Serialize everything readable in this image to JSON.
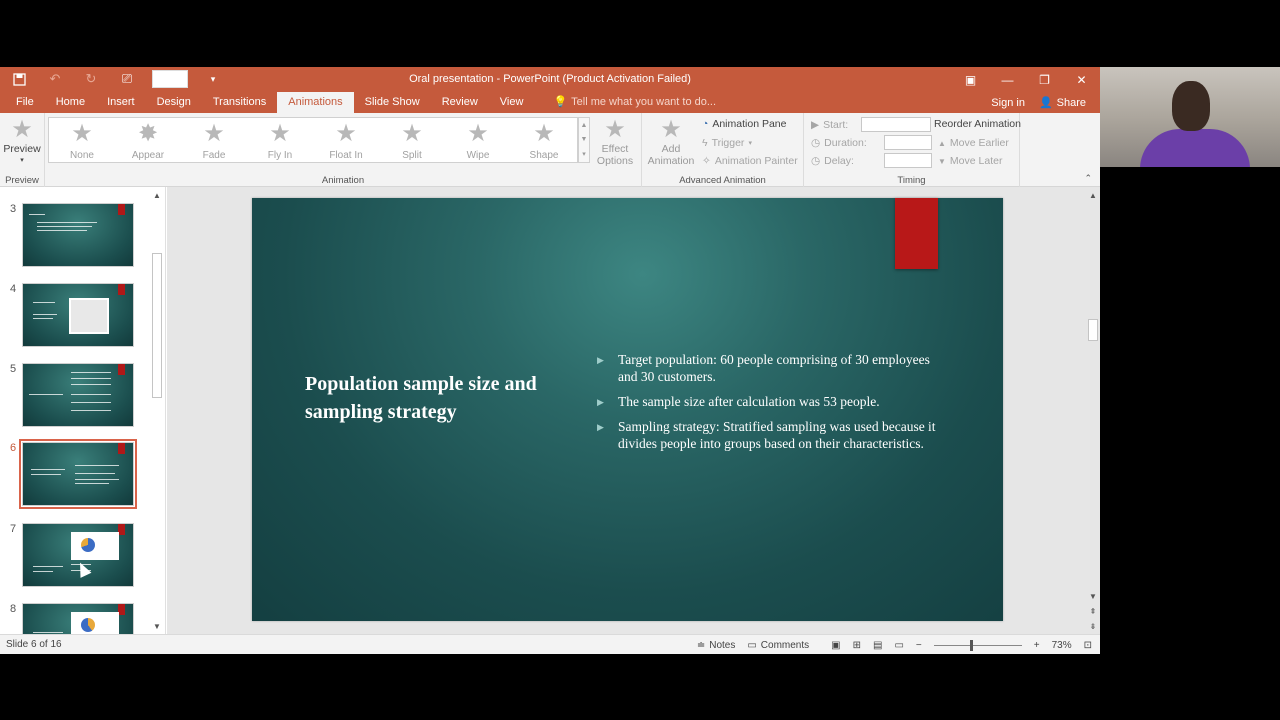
{
  "window": {
    "title": "Oral presentation - PowerPoint (Product Activation Failed)"
  },
  "tabs": {
    "file": "File",
    "home": "Home",
    "insert": "Insert",
    "design": "Design",
    "transitions": "Transitions",
    "animations": "Animations",
    "slideshow": "Slide Show",
    "review": "Review",
    "view": "View",
    "tell": "Tell me what you want to do...",
    "signin": "Sign in",
    "share": "Share"
  },
  "ribbon": {
    "preview": "Preview",
    "preview_group": "Preview",
    "animation_group": "Animation",
    "animations": [
      "None",
      "Appear",
      "Fade",
      "Fly In",
      "Float In",
      "Split",
      "Wipe",
      "Shape"
    ],
    "effect_options_1": "Effect",
    "effect_options_2": "Options",
    "add_animation_1": "Add",
    "add_animation_2": "Animation",
    "animation_pane": "Animation Pane",
    "trigger": "Trigger",
    "animation_painter": "Animation Painter",
    "advanced_group": "Advanced Animation",
    "start": "Start:",
    "duration": "Duration:",
    "delay": "Delay:",
    "reorder": "Reorder Animation",
    "move_earlier": "Move Earlier",
    "move_later": "Move Later",
    "timing_group": "Timing"
  },
  "thumbnails": [
    {
      "num": "3"
    },
    {
      "num": "4"
    },
    {
      "num": "5"
    },
    {
      "num": "6"
    },
    {
      "num": "7"
    },
    {
      "num": "8"
    }
  ],
  "slide": {
    "title": "Population sample size and sampling strategy",
    "bullets": [
      "Target population: 60 people comprising of 30 employees and 30 customers.",
      "The sample size after calculation was 53 people.",
      "Sampling strategy: Stratified sampling was used because it divides people into groups based on their characteristics."
    ]
  },
  "status": {
    "slide_info": "Slide 6 of 16",
    "notes": "Notes",
    "comments": "Comments",
    "zoom": "73%"
  },
  "colors": {
    "accent": "#c55a3c",
    "slide_bg": "#1b4d4e",
    "slide_tag": "#b81818"
  }
}
